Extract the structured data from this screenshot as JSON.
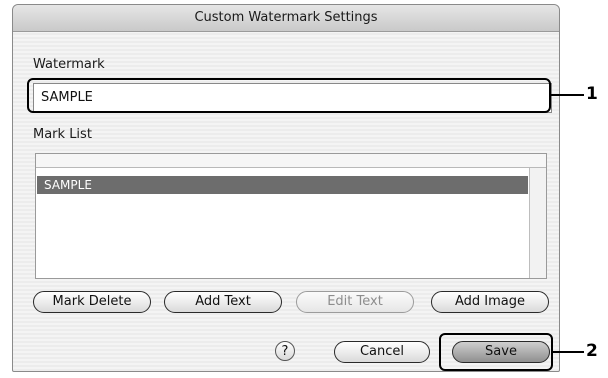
{
  "window": {
    "title": "Custom Watermark Settings"
  },
  "watermark": {
    "label": "Watermark",
    "value": "SAMPLE"
  },
  "mark_list": {
    "label": "Mark List",
    "items": [
      "SAMPLE"
    ],
    "selected": "SAMPLE"
  },
  "buttons": {
    "mark_delete": "Mark Delete",
    "add_text": "Add Text",
    "edit_text": "Edit Text",
    "add_image": "Add Image",
    "help": "?",
    "cancel": "Cancel",
    "save": "Save"
  },
  "callouts": [
    "1",
    "2"
  ]
}
